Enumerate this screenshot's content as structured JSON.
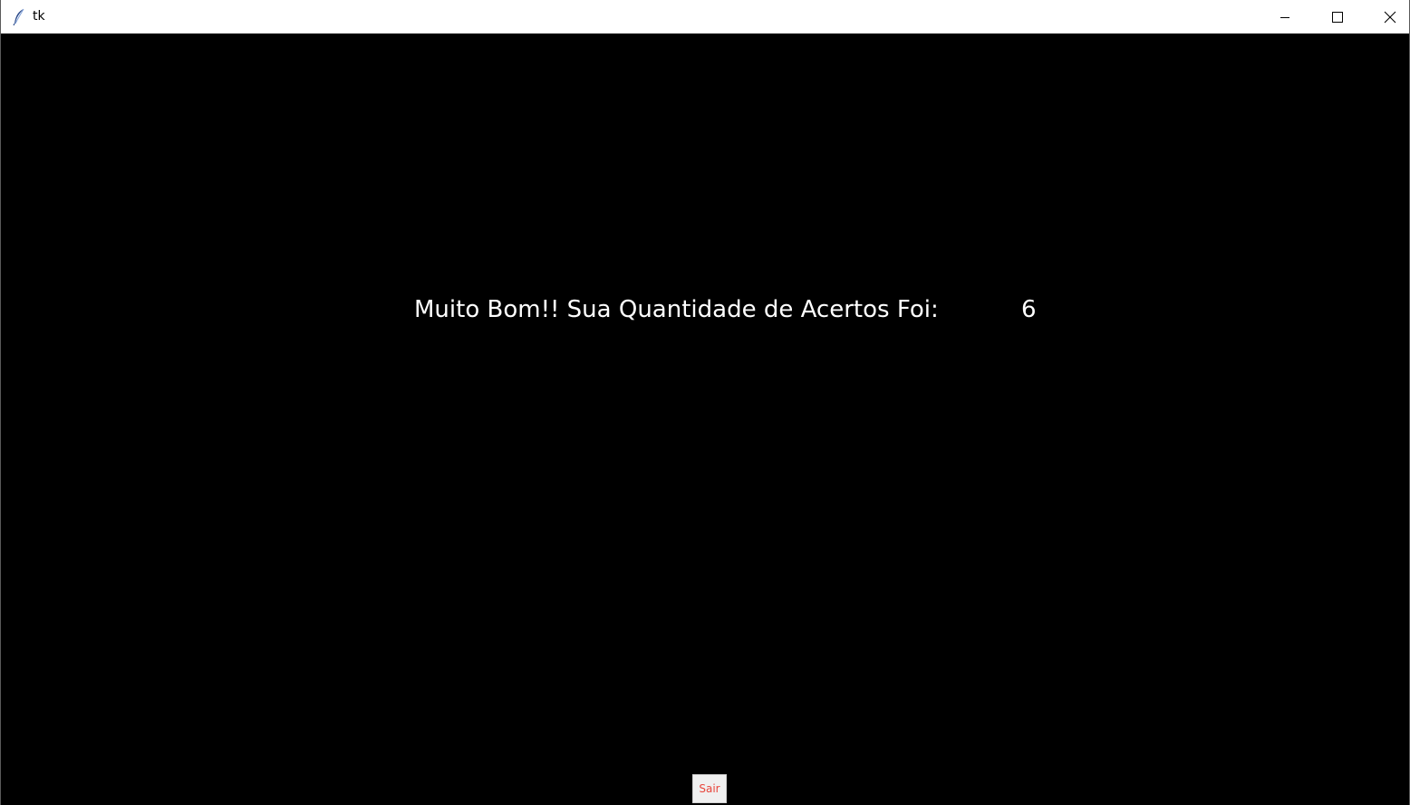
{
  "window": {
    "title": "tk",
    "icon": "feather-icon"
  },
  "caption_buttons": {
    "minimize_icon": "minimize-icon",
    "maximize_icon": "maximize-icon",
    "close_icon": "close-icon"
  },
  "main": {
    "result_message": "Muito Bom!! Sua Quantidade de Acertos Foi:",
    "score": "6",
    "exit_button_label": "Sair"
  },
  "colors": {
    "background": "#000000",
    "text": "#ffffff",
    "exit_button_text": "#e8463c",
    "exit_button_bg": "#f0f0f0"
  }
}
